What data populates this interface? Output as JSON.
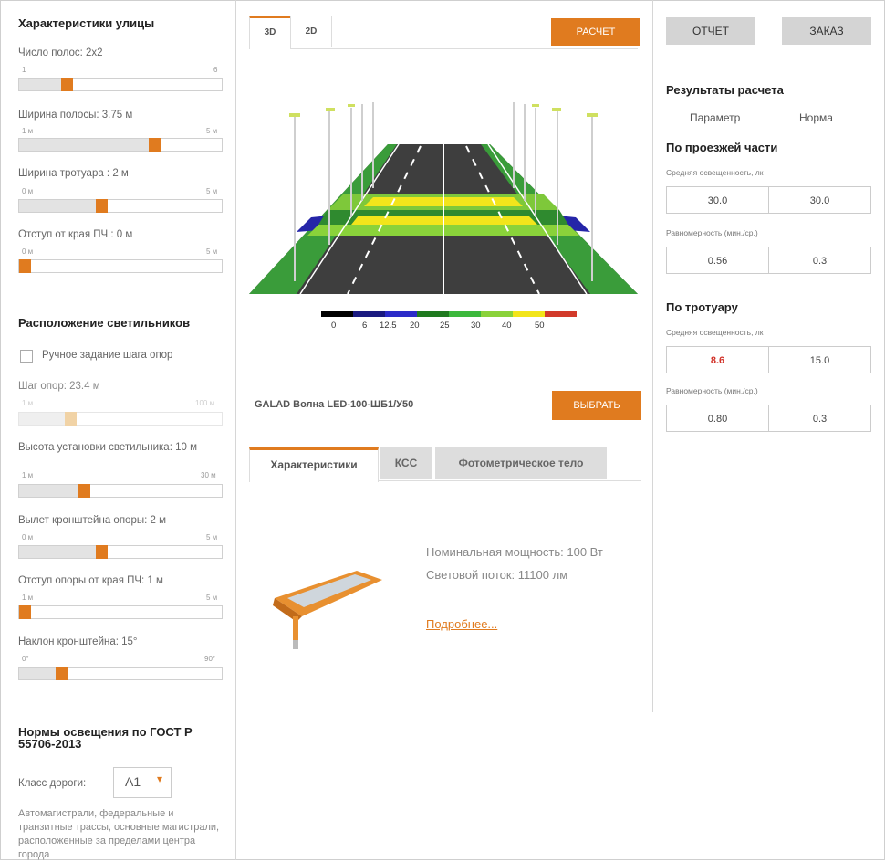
{
  "left": {
    "street_title": "Характеристики улицы",
    "lanes": {
      "label": "Число полос: 2x2",
      "min": "1",
      "max": "6",
      "value": 0.22
    },
    "lane_width": {
      "label": "Ширина полосы: 3.75 м",
      "min": "1 м",
      "max": "5 м",
      "value": 0.68
    },
    "sidewalk": {
      "label": "Ширина тротуара : 2 м",
      "min": "0 м",
      "max": "5 м",
      "value": 0.4
    },
    "offset": {
      "label": "Отступ от края ПЧ : 0 м",
      "min": "0 м",
      "max": "5 м",
      "value": 0.0
    },
    "placement_title": "Расположение светильников",
    "manual_step_label": "Ручное задание шага опор",
    "step": {
      "label": "Шаг опор: 23.4 м",
      "min": "1 м",
      "max": "100 м",
      "value": 0.24
    },
    "height": {
      "label": "Высота установки светильника: 10 м",
      "min": "1 м",
      "max": "30 м",
      "value": 0.31
    },
    "bracket": {
      "label": "Вылет кронштейна опоры: 2 м",
      "min": "0 м",
      "max": "5 м",
      "value": 0.4
    },
    "pole_offset": {
      "label": "Отступ опоры от края ПЧ: 1 м",
      "min": "1 м",
      "max": "5 м",
      "value": 0.0
    },
    "tilt": {
      "label": "Наклон кронштейна: 15°",
      "min": "0°",
      "max": "90°",
      "value": 0.19
    },
    "norms_title": "Нормы освещения по ГОСТ Р 55706-2013",
    "road_class_label": "Класс дороги:",
    "road_class_value": "A1",
    "road_class_desc": "Автомагистрали, федеральные и транзитные трассы, основные магистрали, расположенные за пределами центра города"
  },
  "center": {
    "tab_3d": "3D",
    "tab_2d": "2D",
    "calc_button": "РАСЧЕТ",
    "scale_labels": [
      "0",
      "6",
      "12.5",
      "20",
      "25",
      "30",
      "40",
      "50"
    ],
    "scale_colors": [
      "#000000",
      "#1a1a80",
      "#2b2bc8",
      "#1f7a1f",
      "#3cb83c",
      "#8ad23a",
      "#f2e51b",
      "#d23a2a"
    ],
    "luminaire_name": "GALAD Волна LED-100-ШБ1/У50",
    "choose_button": "ВЫБРАТЬ",
    "tabs": [
      "Характеристики",
      "КСС",
      "Фотометрическое тело"
    ],
    "power": "Номинальная мощность: 100 Вт",
    "flux": "Световой поток: 11100 лм",
    "more_link": "Подробнее..."
  },
  "right": {
    "report_button": "ОТЧЕТ",
    "order_button": "ЗАКАЗ",
    "results_title": "Результаты расчета",
    "col_param": "Параметр",
    "col_norm": "Норма",
    "roadway_title": "По проезжей части",
    "road_avg_label": "Средняя освещенность, лк",
    "road_avg_value": "30.0",
    "road_avg_norm": "30.0",
    "road_uni_label": "Равномерность (мин./ср.)",
    "road_uni_value": "0.56",
    "road_uni_norm": "0.3",
    "sidewalk_title": "По тротуару",
    "side_avg_label": "Средняя освещенность, лк",
    "side_avg_value": "8.6",
    "side_avg_norm": "15.0",
    "side_uni_label": "Равномерность (мин./ср.)",
    "side_uni_value": "0.80",
    "side_uni_norm": "0.3",
    "warn_color": "#d2332a"
  },
  "colors": {
    "accent": "#e07b1f"
  }
}
